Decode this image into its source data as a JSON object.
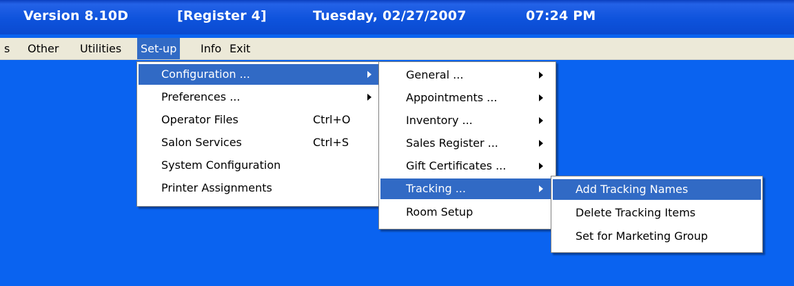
{
  "titlebar": {
    "version": "Version 8.10D",
    "register": "[Register 4]",
    "date": "Tuesday, 02/27/2007",
    "time": "07:24 PM"
  },
  "menubar": {
    "items": [
      {
        "label": "s"
      },
      {
        "label": "Other"
      },
      {
        "label": "Utilities"
      },
      {
        "label": "Set-up",
        "active": true
      },
      {
        "label": "Info"
      },
      {
        "label": "Exit"
      }
    ]
  },
  "setup_menu": {
    "items": [
      {
        "label": "Configuration ...",
        "submenu": true,
        "highlighted": true
      },
      {
        "label": "Preferences ...",
        "submenu": true
      },
      {
        "label": "Operator Files",
        "shortcut": "Ctrl+O"
      },
      {
        "label": "Salon Services",
        "shortcut": "Ctrl+S"
      },
      {
        "label": "System Configuration"
      },
      {
        "label": "Printer Assignments"
      }
    ]
  },
  "configuration_menu": {
    "items": [
      {
        "label": "General ...",
        "submenu": true
      },
      {
        "label": "Appointments ...",
        "submenu": true
      },
      {
        "label": "Inventory ...",
        "submenu": true
      },
      {
        "label": "Sales Register ...",
        "submenu": true
      },
      {
        "label": "Gift Certificates ...",
        "submenu": true
      },
      {
        "label": "Tracking ...",
        "submenu": true,
        "highlighted": true
      },
      {
        "label": "Room Setup"
      }
    ]
  },
  "tracking_menu": {
    "items": [
      {
        "label": "Add Tracking Names",
        "highlighted": true
      },
      {
        "label": "Delete Tracking Items"
      },
      {
        "label": "Set for Marketing Group"
      }
    ]
  },
  "colors": {
    "desktop": "#0a63f0",
    "highlight": "#316ac5",
    "menubar": "#ece9d8"
  }
}
